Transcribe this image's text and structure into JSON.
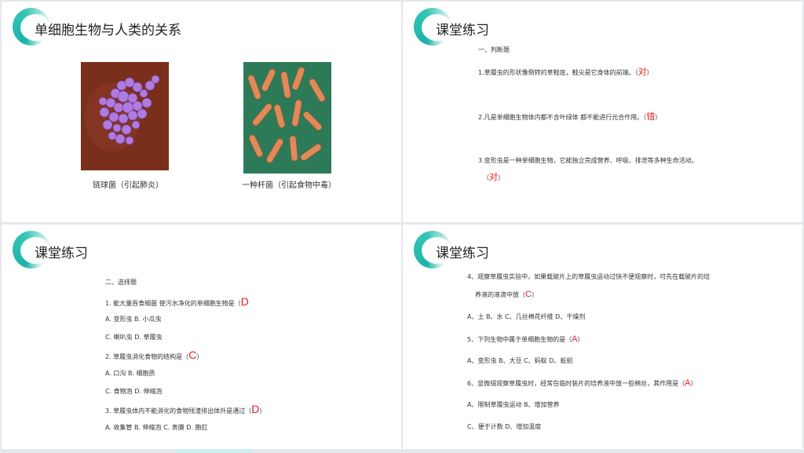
{
  "slide1": {
    "title": "单细胞生物与人类的关系",
    "caption_left": "链球菌（引起肺炎）",
    "caption_right": "一种杆菌（引起食物中毒）"
  },
  "slide2": {
    "title": "课堂练习",
    "section": "一、判断题",
    "q1": "1.草履虫的形状像倒转的草鞋底，鞋尖是它身体的前端。（",
    "q1_answer": "对",
    "q1_end": "）",
    "q2": "2.凡是单细胞生物体内都不含叶绿体    都不能进行光合作用。（",
    "q2_answer": "错",
    "q2_end": "）",
    "q3": "3.变形虫是一种单细胞生物，它能独立完成营养、呼吸、排泄等多种生命活动。",
    "q3_open": "（",
    "q3_answer": "对",
    "q3_end": "）"
  },
  "slide3": {
    "title": "课堂练习",
    "section": "二、选择题",
    "q1": "1. 能大量吞食细菌    使污水净化的单细胞生物是（",
    "q1_answer": "D",
    "q1_opts_a": "A. 变形虫         B. 小瓜虫",
    "q1_opts_b": "C. 喇叭虫         D. 草履虫",
    "q2": "2. 草履虫消化食物的结构是（",
    "q2_answer": "C",
    "q2_end": "）",
    "q2_opts_a": "A. 口沟              B. 细胞质",
    "q2_opts_b": "C. 食物泡                  D. 伸缩泡",
    "q3": "3. 草履虫体内不能消化的食物残渣排出体外是通过（",
    "q3_answer": "D",
    "q3_end": "）",
    "q3_opts": "A. 收集管   B. 伸缩泡   C. 表膜             D. 胞肛"
  },
  "slide4": {
    "title": "课堂练习",
    "q4_line1": "4、观察草履虫实验中，如果载玻片上的草履虫运动过快不便观察时，可先在载玻片的培",
    "q4_line2": "养液的液滴中放（",
    "q4_answer": "C",
    "q4_end": "）",
    "q4_opts": "A、土    B、水  C、几丝棉花纤维     D、干燥剂",
    "q5": "5、下列生物中属于单细胞生物的是（",
    "q5_answer": "A",
    "q5_end": "）",
    "q5_opts": "A、变形虫  B、大豆  C、蚂蚁     D、蚯蚓",
    "q6": "6、显微镜观察草履虫时，经常在临时装片的培养液中放一些棉丝，其作用是（",
    "q6_answer": "A",
    "q6_end": "）",
    "q6_opts_a": "A、限制草履虫运动      B、增加营养",
    "q6_opts_b": "C、便于计数          D、增加温度"
  },
  "colors": {
    "accent": "#1bb3a7",
    "answer": "#e02020"
  }
}
